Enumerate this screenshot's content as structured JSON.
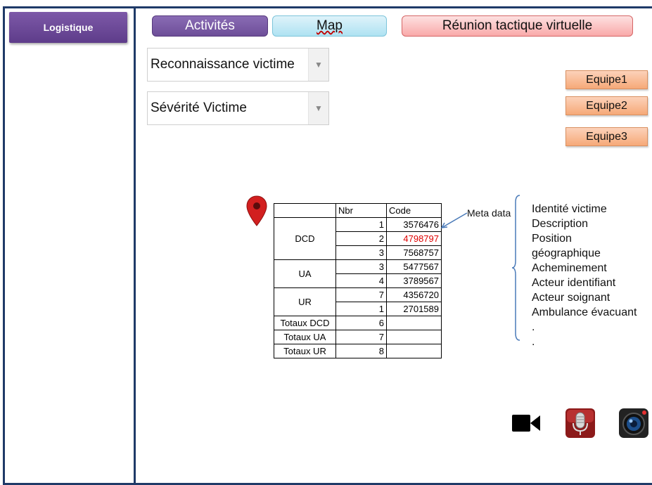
{
  "sidebar": {
    "logistique_label": "Logistique"
  },
  "tabs": [
    {
      "label": "Activités"
    },
    {
      "label": "Map"
    },
    {
      "label": "Réunion tactique virtuelle"
    }
  ],
  "dropdowns": {
    "reconnaissance": {
      "value": "Reconnaissance victime"
    },
    "severite": {
      "value": "Sévérité Victime"
    }
  },
  "teams": [
    "Equipe1",
    "Equipe2",
    "Equipe3"
  ],
  "table": {
    "headers": {
      "category": "",
      "nbr": "Nbr",
      "code": "Code"
    },
    "groups": [
      {
        "label": "DCD",
        "rows": [
          {
            "nbr": "1",
            "code": "3576476"
          },
          {
            "nbr": "2",
            "code": "4798797",
            "highlight": "#e00000"
          },
          {
            "nbr": "3",
            "code": "7568757"
          }
        ]
      },
      {
        "label": "UA",
        "rows": [
          {
            "nbr": "3",
            "code": "5477567"
          },
          {
            "nbr": "4",
            "code": "3789567"
          }
        ]
      },
      {
        "label": "UR",
        "rows": [
          {
            "nbr": "7",
            "code": "4356720"
          },
          {
            "nbr": "1",
            "code": "2701589"
          }
        ]
      }
    ],
    "totals": [
      {
        "label": "Totaux DCD",
        "nbr": "6"
      },
      {
        "label": "Totaux UA",
        "nbr": "7"
      },
      {
        "label": "Totaux UR",
        "nbr": "8"
      }
    ]
  },
  "meta": {
    "label": "Meta data",
    "items": [
      "Identité victime",
      "Description",
      "Position",
      "géographique",
      "Acheminement",
      "Acteur identifiant",
      "Acteur soignant",
      "Ambulance évacuant",
      ".",
      "."
    ]
  },
  "icons": [
    "video-camera-icon",
    "microphone-icon",
    "camera-icon"
  ],
  "colors": {
    "frame": "#1f3a68",
    "sidebar": "#6a4a95",
    "teams": "#f8b88f",
    "map_pin": "#d21f1f"
  }
}
